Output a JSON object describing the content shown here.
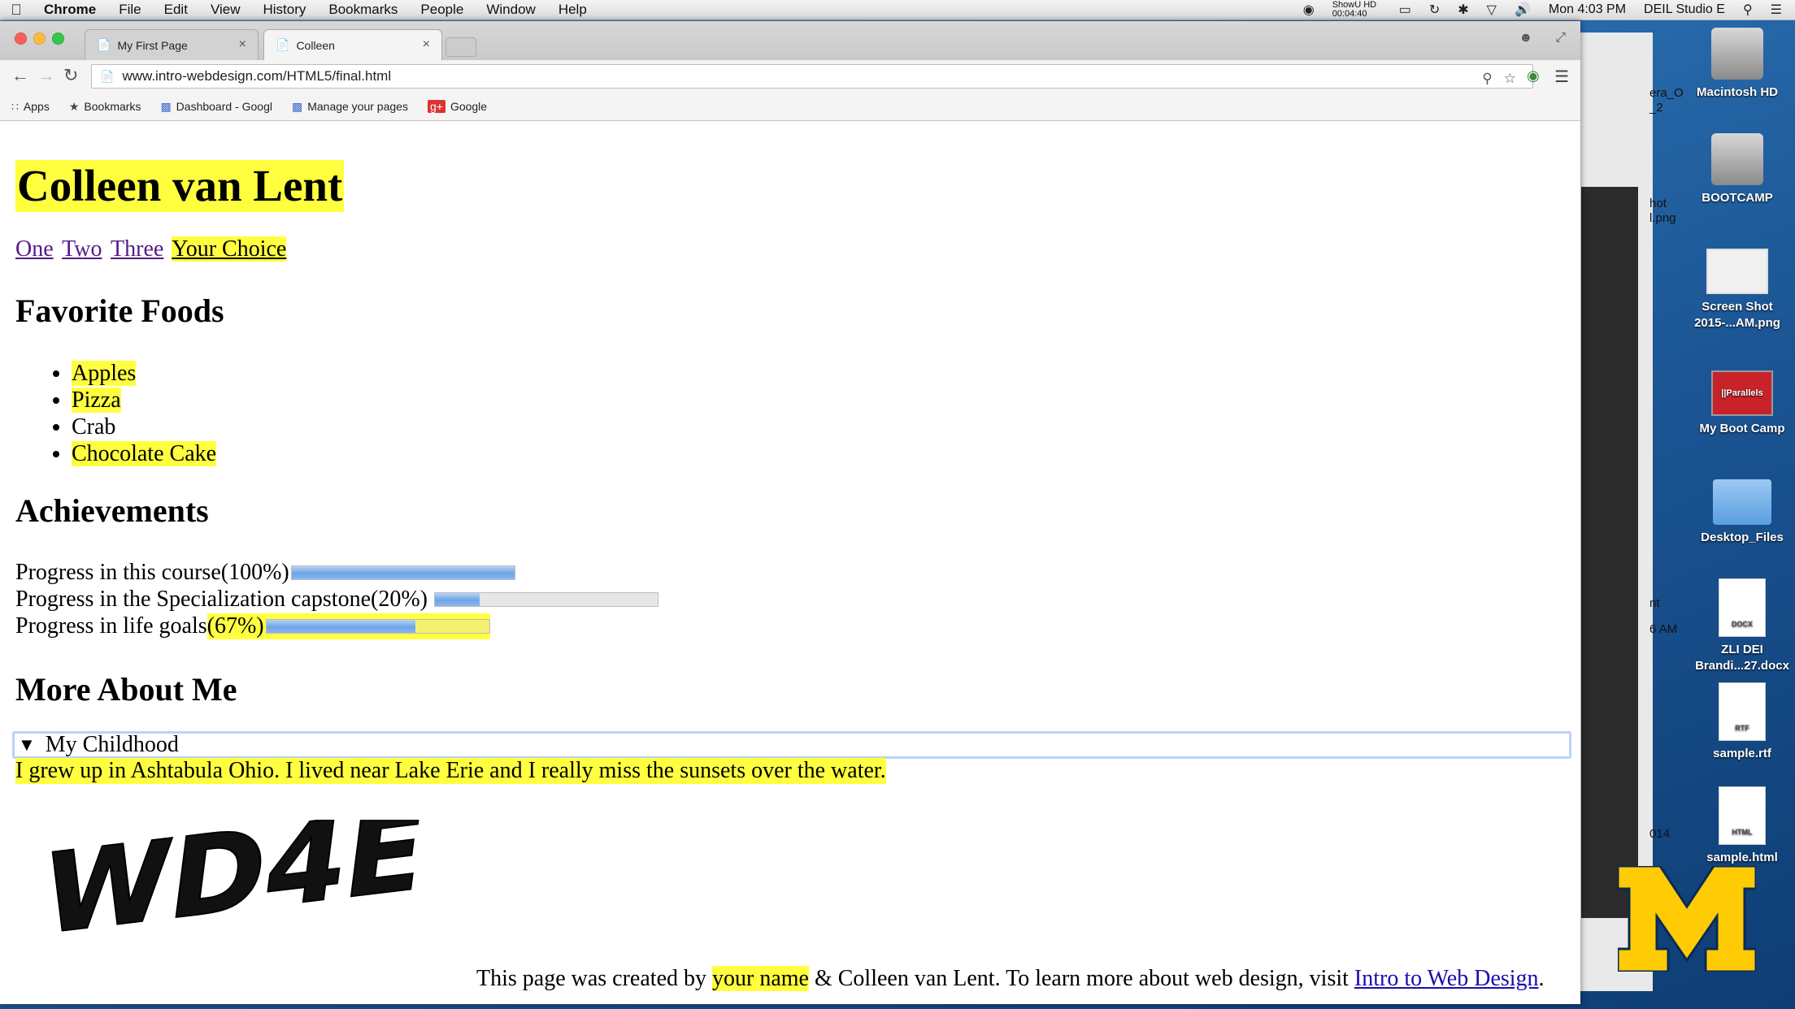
{
  "menubar": {
    "apple": "",
    "items": [
      "Chrome",
      "File",
      "Edit",
      "View",
      "History",
      "Bookmarks",
      "People",
      "Window",
      "Help"
    ],
    "right": {
      "recording": "ShowU HD 00:04:40",
      "clock": "Mon 4:03 PM",
      "user": "DEIL Studio E"
    }
  },
  "browser": {
    "tabs": [
      {
        "title": "My First Page"
      },
      {
        "title": "Colleen"
      }
    ],
    "url": "www.intro-webdesign.com/HTML5/final.html",
    "bookmarks": [
      "Apps",
      "Bookmarks",
      "Dashboard - Googl",
      "Manage your pages",
      "Google"
    ]
  },
  "page": {
    "title": "Colleen van Lent",
    "nav": [
      "One",
      "Two",
      "Three",
      "Your Choice"
    ],
    "foods_heading": "Favorite Foods",
    "foods": [
      "Apples",
      "Pizza",
      "Crab",
      "Chocolate Cake"
    ],
    "achievements_heading": "Achievements",
    "progress": [
      {
        "label": "Progress in this course (100%)",
        "prefix": "Progress in this course ",
        "pct": "(100%)",
        "value": 1.0
      },
      {
        "label": "Progress in the Specialization capstone (20%)",
        "prefix": "Progress in the Specialization capstone ",
        "pct": "(20%)",
        "value": 0.2
      },
      {
        "label": "Progress in life goals (67%)",
        "prefix": "Progress in life goals ",
        "pct": "(67%)",
        "value": 0.67
      }
    ],
    "more_heading": "More About Me",
    "details_summary": "My Childhood",
    "details_text": "I grew up in Ashtabula Ohio. I lived near Lake Erie and I really miss the sunsets over the water.",
    "logo_text": "WD4E",
    "footer": {
      "before": "This page was created by ",
      "name": "your name",
      "middle": " & Colleen van Lent. To learn more about web design, visit ",
      "link": "Intro to Web Design",
      "after": "."
    }
  },
  "background_window": {
    "labels": [
      "era_O",
      "_2",
      "hot",
      "l.png",
      "nt",
      "6 AM",
      "014"
    ]
  },
  "desktop": {
    "icons": [
      {
        "label": "Macintosh HD"
      },
      {
        "label": "BOOTCAMP"
      },
      {
        "label": "Screen Shot 2015-...AM.png"
      },
      {
        "label": "My Boot Camp",
        "badge": "||Parallels"
      },
      {
        "label": "Desktop_Files"
      },
      {
        "label": "ZLI DEI Brandi...27.docx",
        "kind": "DOCX"
      },
      {
        "label": "sample.rtf",
        "kind": "RTF"
      },
      {
        "label": "sample.html",
        "kind": "HTML"
      }
    ]
  },
  "colors": {
    "highlight": "#ffff40",
    "link": "#1a0dab",
    "visited": "#551a8b",
    "maize": "#ffcb05"
  }
}
